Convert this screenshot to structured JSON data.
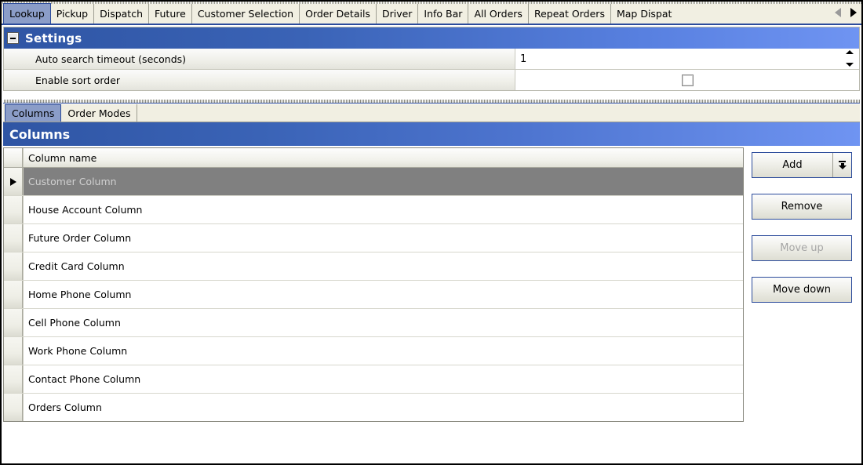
{
  "window": {
    "tabs": [
      {
        "label": "Lookup",
        "active": true
      },
      {
        "label": "Pickup",
        "active": false
      },
      {
        "label": "Dispatch",
        "active": false
      },
      {
        "label": "Future",
        "active": false
      },
      {
        "label": "Customer Selection",
        "active": false
      },
      {
        "label": "Order Details",
        "active": false
      },
      {
        "label": "Driver",
        "active": false
      },
      {
        "label": "Info Bar",
        "active": false
      },
      {
        "label": "All Orders",
        "active": false
      },
      {
        "label": "Repeat Orders",
        "active": false
      },
      {
        "label": "Map Dispat",
        "active": false
      }
    ],
    "scroll_left_icon": "triangle-left-icon",
    "scroll_right_icon": "triangle-right-icon"
  },
  "settings": {
    "title": "Settings",
    "collapse_icon": "minus-icon",
    "rows": [
      {
        "label": "Auto search timeout (seconds)",
        "type": "spinner",
        "value": "1"
      },
      {
        "label": "Enable sort order",
        "type": "checkbox",
        "checked": false
      }
    ]
  },
  "inner_tabs": [
    {
      "label": "Columns",
      "active": true
    },
    {
      "label": "Order Modes",
      "active": false
    }
  ],
  "columns_panel": {
    "title": "Columns",
    "grid": {
      "header": "Column name",
      "rows": [
        {
          "name": "Customer Column",
          "selected": true
        },
        {
          "name": "House Account Column",
          "selected": false
        },
        {
          "name": "Future Order Column",
          "selected": false
        },
        {
          "name": "Credit Card Column",
          "selected": false
        },
        {
          "name": "Home Phone Column",
          "selected": false
        },
        {
          "name": "Cell Phone Column",
          "selected": false
        },
        {
          "name": "Work Phone Column",
          "selected": false
        },
        {
          "name": "Contact Phone Column",
          "selected": false
        },
        {
          "name": "Orders Column",
          "selected": false
        }
      ]
    },
    "buttons": [
      {
        "label": "Add",
        "disabled": false,
        "split": true,
        "arrow_icon": "insert-down-arrow-icon"
      },
      {
        "label": "Remove",
        "disabled": false,
        "split": false
      },
      {
        "label": "Move up",
        "disabled": true,
        "split": false
      },
      {
        "label": "Move down",
        "disabled": false,
        "split": false
      }
    ]
  },
  "colors": {
    "header_blue_dark": "#2F55A4",
    "header_blue_light": "#6F94F2",
    "tab_active": "#8B9DC8",
    "selected_row": "#808080",
    "button_border": "#2B4B9B"
  }
}
